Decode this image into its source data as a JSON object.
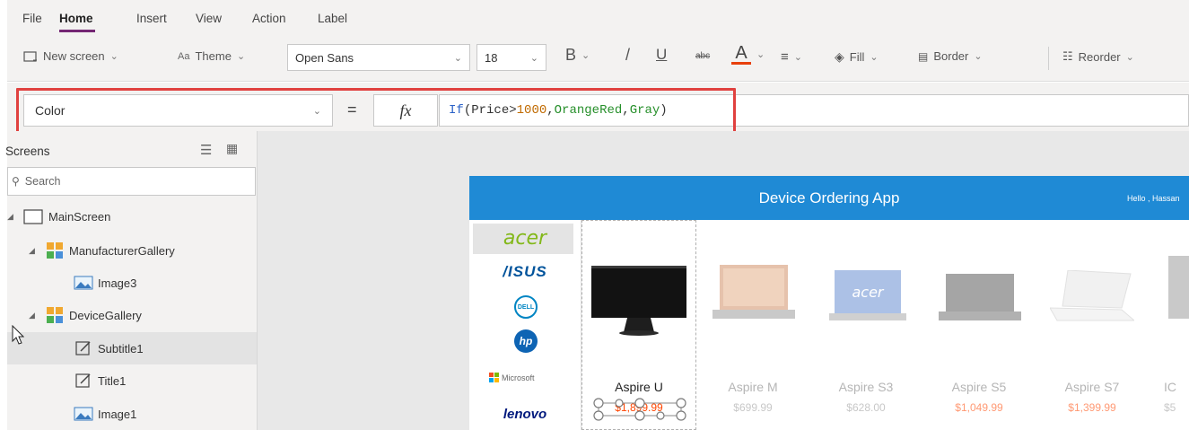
{
  "menu": {
    "tabs": [
      {
        "label": "File"
      },
      {
        "label": "Home"
      },
      {
        "label": "Insert"
      },
      {
        "label": "View"
      },
      {
        "label": "Action"
      },
      {
        "label": "Label"
      }
    ],
    "active": "Home",
    "accent": "#742774"
  },
  "ribbon": {
    "new_screen": "New screen",
    "theme": "Theme",
    "font_family": "Open Sans",
    "font_size": "18",
    "bold": "B",
    "italic": "/",
    "underline": "U",
    "strike": "abc",
    "font_color_letter": "A",
    "font_color_accent": "#e8400c",
    "fill": "Fill",
    "border": "Border",
    "reorder": "Reorder"
  },
  "formula_bar": {
    "property": "Color",
    "equals": "=",
    "fx": "fx",
    "formula_tokens": [
      {
        "text": "If",
        "color": "#2b62c7"
      },
      {
        "text": "(",
        "color": "#333333"
      },
      {
        "text": "Price",
        "color": "#333333"
      },
      {
        "text": ">",
        "color": "#333333"
      },
      {
        "text": "1000",
        "color": "#c06a00"
      },
      {
        "text": ",",
        "color": "#333333"
      },
      {
        "text": "OrangeRed",
        "color": "#268f2a"
      },
      {
        "text": ",",
        "color": "#333333"
      },
      {
        "text": "Gray",
        "color": "#268f2a"
      },
      {
        "text": ")",
        "color": "#333333"
      }
    ],
    "highlight_color": "#e0413f"
  },
  "tree": {
    "header": "Screens",
    "search_placeholder": "Search",
    "items": [
      {
        "label": "MainScreen",
        "icon": "screen-icon"
      },
      {
        "label": "ManufacturerGallery",
        "icon": "gallery-icon"
      },
      {
        "label": "Image3",
        "icon": "image-icon"
      },
      {
        "label": "DeviceGallery",
        "icon": "gallery-icon"
      },
      {
        "label": "Subtitle1",
        "icon": "label-icon"
      },
      {
        "label": "Title1",
        "icon": "label-icon"
      },
      {
        "label": "Image1",
        "icon": "image-icon"
      }
    ]
  },
  "app": {
    "title": "Device Ordering App",
    "greeting": "Hello , Hassan",
    "header_color": "#1f8ad5",
    "manufacturers": [
      "acer",
      "/ISUS",
      "DELL",
      "hp",
      "Microsoft",
      "lenovo"
    ],
    "devices": [
      {
        "name": "Aspire U",
        "price": "$1,899.99",
        "price_color": "#ff4500"
      },
      {
        "name": "Aspire M",
        "price": "$699.99",
        "price_color": "#9a9a9a"
      },
      {
        "name": "Aspire S3",
        "price": "$628.00",
        "price_color": "#9a9a9a"
      },
      {
        "name": "Aspire S5",
        "price": "$1,049.99",
        "price_color": "#ff4500"
      },
      {
        "name": "Aspire S7",
        "price": "$1,399.99",
        "price_color": "#ff4500"
      },
      {
        "name": "IC",
        "price": "$5",
        "price_color": "#9a9a9a"
      }
    ]
  }
}
